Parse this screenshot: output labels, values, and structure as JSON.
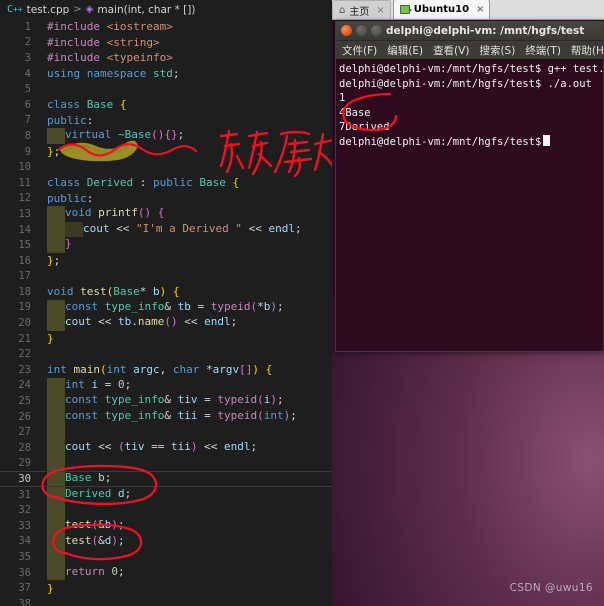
{
  "editor": {
    "breadcrumb": {
      "lang_icon": "cpp-icon",
      "file": "test.cpp",
      "separator": ">",
      "symbol_icon": "method-symbol-icon",
      "symbol": "main(int, char * [])"
    },
    "lines": [
      {
        "n": "1",
        "tokens": [
          {
            "t": "#include",
            "c": "t-pre"
          },
          {
            "t": " ",
            "c": "t-plain"
          },
          {
            "t": "<iostream>",
            "c": "t-str"
          }
        ]
      },
      {
        "n": "2",
        "tokens": [
          {
            "t": "#include",
            "c": "t-pre"
          },
          {
            "t": " ",
            "c": "t-plain"
          },
          {
            "t": "<string>",
            "c": "t-str"
          }
        ]
      },
      {
        "n": "3",
        "tokens": [
          {
            "t": "#include",
            "c": "t-pre"
          },
          {
            "t": " ",
            "c": "t-plain"
          },
          {
            "t": "<typeinfo>",
            "c": "t-str"
          }
        ]
      },
      {
        "n": "4",
        "tokens": [
          {
            "t": "using",
            "c": "t-kw"
          },
          {
            "t": " ",
            "c": "t-plain"
          },
          {
            "t": "namespace",
            "c": "t-kw"
          },
          {
            "t": " ",
            "c": "t-plain"
          },
          {
            "t": "std",
            "c": "t-type"
          },
          {
            "t": ";",
            "c": "t-punc"
          }
        ]
      },
      {
        "n": "5",
        "tokens": []
      },
      {
        "n": "6",
        "tokens": [
          {
            "t": "class",
            "c": "t-kw"
          },
          {
            "t": " ",
            "c": "t-plain"
          },
          {
            "t": "Base",
            "c": "t-type"
          },
          {
            "t": " ",
            "c": "t-plain"
          },
          {
            "t": "{",
            "c": "t-br1"
          }
        ]
      },
      {
        "n": "7",
        "tokens": [
          {
            "t": "public",
            "c": "t-kw"
          },
          {
            "t": ":",
            "c": "t-punc"
          }
        ]
      },
      {
        "n": "8",
        "indent": 1,
        "tokens": [
          {
            "t": "virtual",
            "c": "t-kw"
          },
          {
            "t": " ",
            "c": "t-plain"
          },
          {
            "t": "~Base",
            "c": "t-type"
          },
          {
            "t": "(",
            "c": "t-br2"
          },
          {
            "t": ")",
            "c": "t-br2"
          },
          {
            "t": "{",
            "c": "t-br2"
          },
          {
            "t": "}",
            "c": "t-br2"
          },
          {
            "t": ";",
            "c": "t-punc"
          }
        ]
      },
      {
        "n": "9",
        "tokens": [
          {
            "t": "}",
            "c": "t-br1"
          },
          {
            "t": ";",
            "c": "t-punc"
          }
        ]
      },
      {
        "n": "10",
        "tokens": []
      },
      {
        "n": "11",
        "tokens": [
          {
            "t": "class",
            "c": "t-kw"
          },
          {
            "t": " ",
            "c": "t-plain"
          },
          {
            "t": "Derived",
            "c": "t-type"
          },
          {
            "t": " : ",
            "c": "t-plain"
          },
          {
            "t": "public",
            "c": "t-kw"
          },
          {
            "t": " ",
            "c": "t-plain"
          },
          {
            "t": "Base",
            "c": "t-type"
          },
          {
            "t": " ",
            "c": "t-plain"
          },
          {
            "t": "{",
            "c": "t-br1"
          }
        ]
      },
      {
        "n": "12",
        "tokens": [
          {
            "t": "public",
            "c": "t-kw"
          },
          {
            "t": ":",
            "c": "t-punc"
          }
        ]
      },
      {
        "n": "13",
        "indent": 1,
        "tokens": [
          {
            "t": "void",
            "c": "t-kw"
          },
          {
            "t": " ",
            "c": "t-plain"
          },
          {
            "t": "printf",
            "c": "t-fn"
          },
          {
            "t": "(",
            "c": "t-br2"
          },
          {
            "t": ")",
            "c": "t-br2"
          },
          {
            "t": " ",
            "c": "t-plain"
          },
          {
            "t": "{",
            "c": "t-br2"
          }
        ]
      },
      {
        "n": "14",
        "indent": 2,
        "tokens": [
          {
            "t": "cout",
            "c": "t-var"
          },
          {
            "t": " << ",
            "c": "t-op"
          },
          {
            "t": "\"I'm a Derived \"",
            "c": "t-str"
          },
          {
            "t": " << ",
            "c": "t-op"
          },
          {
            "t": "endl",
            "c": "t-var"
          },
          {
            "t": ";",
            "c": "t-punc"
          }
        ]
      },
      {
        "n": "15",
        "indent": 1,
        "tokens": [
          {
            "t": "}",
            "c": "t-br2"
          }
        ]
      },
      {
        "n": "16",
        "tokens": [
          {
            "t": "}",
            "c": "t-br1"
          },
          {
            "t": ";",
            "c": "t-punc"
          }
        ]
      },
      {
        "n": "17",
        "tokens": []
      },
      {
        "n": "18",
        "tokens": [
          {
            "t": "void",
            "c": "t-kw"
          },
          {
            "t": " ",
            "c": "t-plain"
          },
          {
            "t": "test",
            "c": "t-fn"
          },
          {
            "t": "(",
            "c": "t-br1"
          },
          {
            "t": "Base",
            "c": "t-type"
          },
          {
            "t": "*",
            "c": "t-op"
          },
          {
            "t": " ",
            "c": "t-plain"
          },
          {
            "t": "b",
            "c": "t-var"
          },
          {
            "t": ")",
            "c": "t-br1"
          },
          {
            "t": " ",
            "c": "t-plain"
          },
          {
            "t": "{",
            "c": "t-br1"
          }
        ]
      },
      {
        "n": "19",
        "indent": 1,
        "tokens": [
          {
            "t": "const",
            "c": "t-kw"
          },
          {
            "t": " ",
            "c": "t-plain"
          },
          {
            "t": "type_info",
            "c": "t-type"
          },
          {
            "t": "&",
            "c": "t-op"
          },
          {
            "t": " ",
            "c": "t-plain"
          },
          {
            "t": "tb",
            "c": "t-var"
          },
          {
            "t": " = ",
            "c": "t-op"
          },
          {
            "t": "typeid",
            "c": "t-kw2"
          },
          {
            "t": "(",
            "c": "t-br2"
          },
          {
            "t": "*",
            "c": "t-op"
          },
          {
            "t": "b",
            "c": "t-var"
          },
          {
            "t": ")",
            "c": "t-br2"
          },
          {
            "t": ";",
            "c": "t-punc"
          }
        ]
      },
      {
        "n": "20",
        "indent": 1,
        "tokens": [
          {
            "t": "cout",
            "c": "t-var"
          },
          {
            "t": " << ",
            "c": "t-op"
          },
          {
            "t": "tb",
            "c": "t-var"
          },
          {
            "t": ".",
            "c": "t-punc"
          },
          {
            "t": "name",
            "c": "t-fn"
          },
          {
            "t": "(",
            "c": "t-br2"
          },
          {
            "t": ")",
            "c": "t-br2"
          },
          {
            "t": " << ",
            "c": "t-op"
          },
          {
            "t": "endl",
            "c": "t-var"
          },
          {
            "t": ";",
            "c": "t-punc"
          }
        ]
      },
      {
        "n": "21",
        "tokens": [
          {
            "t": "}",
            "c": "t-br1"
          }
        ]
      },
      {
        "n": "22",
        "tokens": []
      },
      {
        "n": "23",
        "tokens": [
          {
            "t": "int",
            "c": "t-kw"
          },
          {
            "t": " ",
            "c": "t-plain"
          },
          {
            "t": "main",
            "c": "t-fn"
          },
          {
            "t": "(",
            "c": "t-br1"
          },
          {
            "t": "int",
            "c": "t-kw"
          },
          {
            "t": " ",
            "c": "t-plain"
          },
          {
            "t": "argc",
            "c": "t-var"
          },
          {
            "t": ", ",
            "c": "t-punc"
          },
          {
            "t": "char",
            "c": "t-kw"
          },
          {
            "t": " ",
            "c": "t-plain"
          },
          {
            "t": "*",
            "c": "t-op"
          },
          {
            "t": "argv",
            "c": "t-var"
          },
          {
            "t": "[",
            "c": "t-br2"
          },
          {
            "t": "]",
            "c": "t-br2"
          },
          {
            "t": ")",
            "c": "t-br1"
          },
          {
            "t": " ",
            "c": "t-plain"
          },
          {
            "t": "{",
            "c": "t-br1"
          }
        ]
      },
      {
        "n": "24",
        "indent": 1,
        "tokens": [
          {
            "t": "int",
            "c": "t-kw"
          },
          {
            "t": " ",
            "c": "t-plain"
          },
          {
            "t": "i",
            "c": "t-var"
          },
          {
            "t": " = ",
            "c": "t-op"
          },
          {
            "t": "0",
            "c": "t-num"
          },
          {
            "t": ";",
            "c": "t-punc"
          }
        ]
      },
      {
        "n": "25",
        "indent": 1,
        "tokens": [
          {
            "t": "const",
            "c": "t-kw"
          },
          {
            "t": " ",
            "c": "t-plain"
          },
          {
            "t": "type_info",
            "c": "t-type"
          },
          {
            "t": "&",
            "c": "t-op"
          },
          {
            "t": " ",
            "c": "t-plain"
          },
          {
            "t": "tiv",
            "c": "t-var"
          },
          {
            "t": " = ",
            "c": "t-op"
          },
          {
            "t": "typeid",
            "c": "t-kw2"
          },
          {
            "t": "(",
            "c": "t-br2"
          },
          {
            "t": "i",
            "c": "t-var"
          },
          {
            "t": ")",
            "c": "t-br2"
          },
          {
            "t": ";",
            "c": "t-punc"
          }
        ]
      },
      {
        "n": "26",
        "indent": 1,
        "tokens": [
          {
            "t": "const",
            "c": "t-kw"
          },
          {
            "t": " ",
            "c": "t-plain"
          },
          {
            "t": "type_info",
            "c": "t-type"
          },
          {
            "t": "&",
            "c": "t-op"
          },
          {
            "t": " ",
            "c": "t-plain"
          },
          {
            "t": "tii",
            "c": "t-var"
          },
          {
            "t": " = ",
            "c": "t-op"
          },
          {
            "t": "typeid",
            "c": "t-kw2"
          },
          {
            "t": "(",
            "c": "t-br2"
          },
          {
            "t": "int",
            "c": "t-kw"
          },
          {
            "t": ")",
            "c": "t-br2"
          },
          {
            "t": ";",
            "c": "t-punc"
          }
        ]
      },
      {
        "n": "27",
        "indent": 1,
        "tokens": []
      },
      {
        "n": "28",
        "indent": 1,
        "tokens": [
          {
            "t": "cout",
            "c": "t-var"
          },
          {
            "t": " << ",
            "c": "t-op"
          },
          {
            "t": "(",
            "c": "t-br2"
          },
          {
            "t": "tiv",
            "c": "t-var"
          },
          {
            "t": " == ",
            "c": "t-op"
          },
          {
            "t": "tii",
            "c": "t-var"
          },
          {
            "t": ")",
            "c": "t-br2"
          },
          {
            "t": " << ",
            "c": "t-op"
          },
          {
            "t": "endl",
            "c": "t-var"
          },
          {
            "t": ";",
            "c": "t-punc"
          }
        ]
      },
      {
        "n": "29",
        "indent": 1,
        "tokens": []
      },
      {
        "n": "30",
        "indent": 1,
        "active": true,
        "tokens": [
          {
            "t": "Base",
            "c": "t-type"
          },
          {
            "t": " ",
            "c": "t-plain"
          },
          {
            "t": "b",
            "c": "t-var"
          },
          {
            "t": ";",
            "c": "t-punc"
          }
        ]
      },
      {
        "n": "31",
        "indent": 1,
        "tokens": [
          {
            "t": "Derived",
            "c": "t-type"
          },
          {
            "t": " ",
            "c": "t-plain"
          },
          {
            "t": "d",
            "c": "t-var"
          },
          {
            "t": ";",
            "c": "t-punc"
          }
        ]
      },
      {
        "n": "32",
        "indent": 1,
        "tokens": []
      },
      {
        "n": "33",
        "indent": 1,
        "tokens": [
          {
            "t": "test",
            "c": "t-fn"
          },
          {
            "t": "(",
            "c": "t-br2"
          },
          {
            "t": "&",
            "c": "t-op"
          },
          {
            "t": "b",
            "c": "t-var"
          },
          {
            "t": ")",
            "c": "t-br2"
          },
          {
            "t": ";",
            "c": "t-punc"
          }
        ]
      },
      {
        "n": "34",
        "indent": 1,
        "tokens": [
          {
            "t": "test",
            "c": "t-fn"
          },
          {
            "t": "(",
            "c": "t-br2"
          },
          {
            "t": "&",
            "c": "t-op"
          },
          {
            "t": "d",
            "c": "t-var"
          },
          {
            "t": ")",
            "c": "t-br2"
          },
          {
            "t": ";",
            "c": "t-punc"
          }
        ]
      },
      {
        "n": "35",
        "indent": 1,
        "tokens": []
      },
      {
        "n": "36",
        "indent": 1,
        "tokens": [
          {
            "t": "return",
            "c": "t-kw2"
          },
          {
            "t": " ",
            "c": "t-plain"
          },
          {
            "t": "0",
            "c": "t-num"
          },
          {
            "t": ";",
            "c": "t-punc"
          }
        ]
      },
      {
        "n": "37",
        "tokens": [
          {
            "t": "}",
            "c": "t-br1"
          }
        ]
      },
      {
        "n": "38",
        "tokens": []
      }
    ],
    "annotations": {
      "handwriting_note": "存反产出报",
      "ink_color": "#ee1122",
      "highlight_color": "#b3a12a"
    }
  },
  "vmware": {
    "tabs": [
      {
        "label": "主页",
        "icon": "home-icon",
        "active": false,
        "close": "×"
      },
      {
        "label": "Ubuntu10",
        "icon": "vm-icon",
        "active": true,
        "close": "×"
      }
    ]
  },
  "terminal": {
    "title": "delphi@delphi-vm: /mnt/hgfs/test",
    "window_buttons": {
      "close": "close-icon",
      "minimize": "minimize-icon",
      "maximize": "maximize-icon"
    },
    "menu": [
      "文件(F)",
      "编辑(E)",
      "查看(V)",
      "搜索(S)",
      "终端(T)",
      "帮助(H)"
    ],
    "lines": [
      "delphi@delphi-vm:/mnt/hgfs/test$ g++ test.cpp",
      "delphi@delphi-vm:/mnt/hgfs/test$ ./a.out",
      "1",
      "4Base",
      "7Derived"
    ],
    "prompt": "delphi@delphi-vm:/mnt/hgfs/test$"
  },
  "desktop": {
    "watermark": "CSDN @uwu16"
  }
}
